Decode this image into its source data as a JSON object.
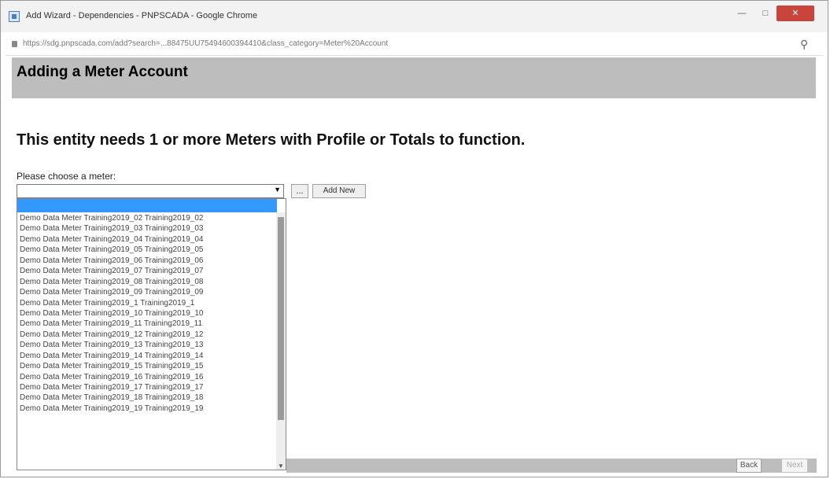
{
  "window": {
    "title": "Add Wizard - Dependencies - PNPSCADA - Google Chrome",
    "minimize_glyph": "—",
    "maximize_glyph": "□",
    "close_glyph": "✕"
  },
  "address_bar": {
    "url": "https://sdg.pnpscada.com/add?search=...88475UU75494600394410&class_category=Meter%20Account",
    "zoom_icon": "magnifier-icon",
    "zoom_glyph": "⚲"
  },
  "page": {
    "title": "Adding a Meter Account",
    "notice": "This entity needs 1 or more Meters with Profile or Totals to function.",
    "choose_label": "Please choose a meter:"
  },
  "meter_select": {
    "selected_value": "",
    "arrow_glyph": "▼",
    "options": [
      "Demo Data Meter Training2019_02 Training2019_02",
      "Demo Data Meter Training2019_03 Training2019_03",
      "Demo Data Meter Training2019_04 Training2019_04",
      "Demo Data Meter Training2019_05 Training2019_05",
      "Demo Data Meter Training2019_06 Training2019_06",
      "Demo Data Meter Training2019_07 Training2019_07",
      "Demo Data Meter Training2019_08 Training2019_08",
      "Demo Data Meter Training2019_09 Training2019_09",
      "Demo Data Meter Training2019_1 Training2019_1",
      "Demo Data Meter Training2019_10 Training2019_10",
      "Demo Data Meter Training2019_11 Training2019_11",
      "Demo Data Meter Training2019_12 Training2019_12",
      "Demo Data Meter Training2019_13 Training2019_13",
      "Demo Data Meter Training2019_14 Training2019_14",
      "Demo Data Meter Training2019_15 Training2019_15",
      "Demo Data Meter Training2019_16 Training2019_16",
      "Demo Data Meter Training2019_17 Training2019_17",
      "Demo Data Meter Training2019_18 Training2019_18",
      "Demo Data Meter Training2019_19 Training2019_19"
    ]
  },
  "buttons": {
    "dots": "...",
    "add_new": "Add New",
    "back": "Back",
    "next": "Next"
  },
  "colors": {
    "header_band": "#bdbdbd",
    "selection_highlight": "#3399ff",
    "close_button": "#c9453b"
  }
}
